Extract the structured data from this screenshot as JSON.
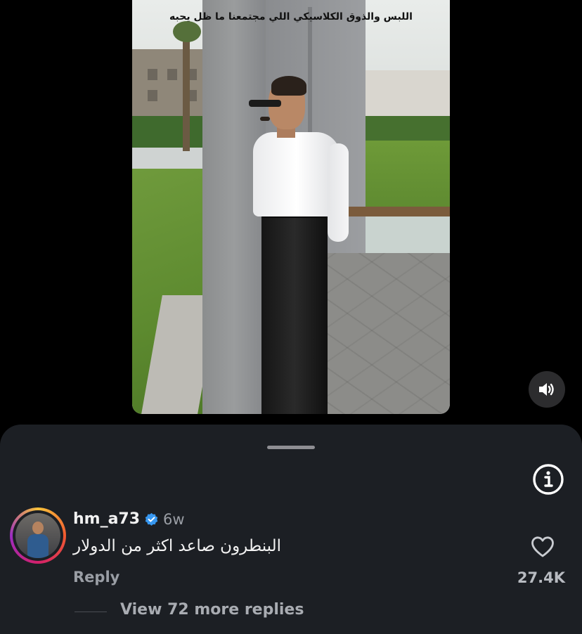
{
  "video": {
    "caption": "اللبس والذوق الكلاسيكي اللي مجتمعنا ما ظل يحبه"
  },
  "controls": {
    "mute_icon": "speaker-sound-icon",
    "info_icon": "info-circle-icon"
  },
  "comment": {
    "username": "hm_a73",
    "verified": true,
    "time": "6w",
    "text": "البنطرون صاعد اكثر من الدولار",
    "reply_label": "Reply",
    "likes": "27.4K",
    "view_more_label": "View 72 more replies"
  },
  "colors": {
    "sheet_bg": "#1c1f24",
    "verified_blue": "#3797f0",
    "muted_text": "#9a9ea5"
  }
}
